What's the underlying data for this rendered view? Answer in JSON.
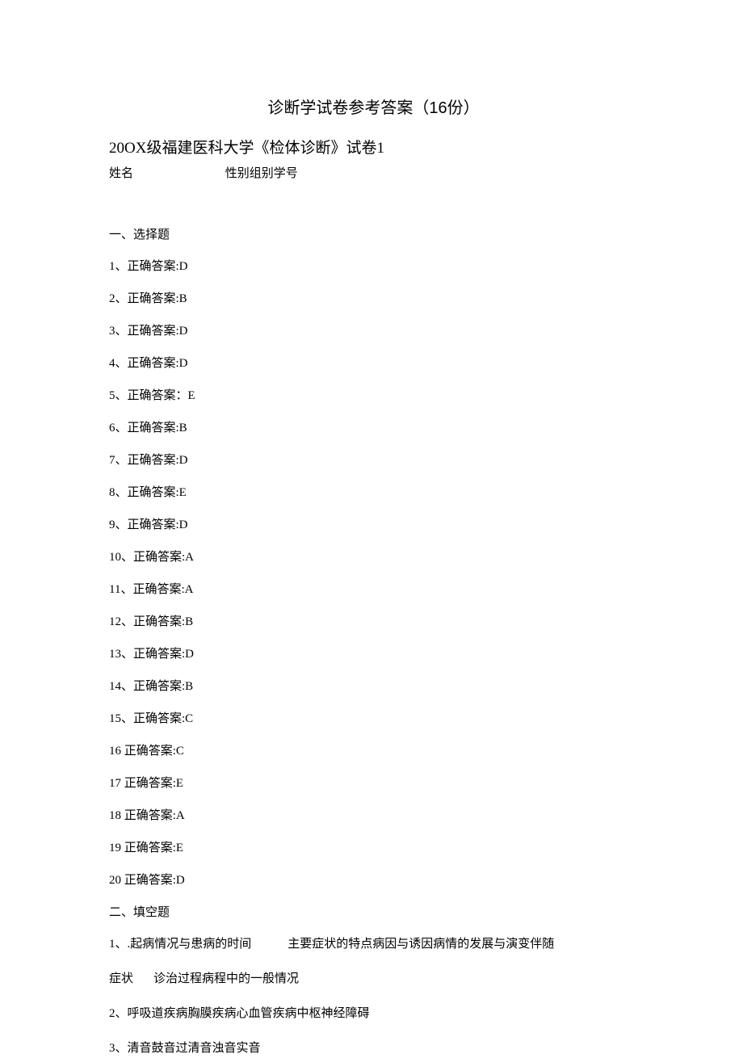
{
  "title": "诊断学试卷参考答案（16份）",
  "subtitle": "20OX级福建医科大学《检体诊断》试卷1",
  "info": {
    "name_label": "姓名",
    "fields_label": "性别组别学号"
  },
  "section1": {
    "header": "一、选择题",
    "answers": [
      {
        "num": "1、",
        "label": "正确答案:D"
      },
      {
        "num": "2、",
        "label": "正确答案:B"
      },
      {
        "num": "3、",
        "label": "正确答案:D"
      },
      {
        "num": "4、",
        "label": "正确答案:D"
      },
      {
        "num": "5、",
        "label": "正确答案：E"
      },
      {
        "num": "6、",
        "label": "正确答案:B"
      },
      {
        "num": "7、",
        "label": "正确答案:D"
      },
      {
        "num": "8、",
        "label": "正确答案:E"
      },
      {
        "num": "9、",
        "label": "正确答案:D"
      },
      {
        "num": "10、",
        "label": "正确答案:A"
      },
      {
        "num": "11、",
        "label": "正确答案:A"
      },
      {
        "num": "12、",
        "label": "正确答案:B"
      },
      {
        "num": "13、",
        "label": "正确答案:D"
      },
      {
        "num": "14、",
        "label": "正确答案:B"
      },
      {
        "num": "15、",
        "label": "正确答案:C"
      },
      {
        "num": "16",
        "label": "正确答案:C"
      },
      {
        "num": "17",
        "label": "正确答案:E"
      },
      {
        "num": "18",
        "label": "正确答案:A"
      },
      {
        "num": "19",
        "label": "正确答案:E"
      },
      {
        "num": "20",
        "label": "正确答案:D"
      }
    ]
  },
  "section2": {
    "header": "二、填空题",
    "item1_part1": "1、.起病情况与患病的时间",
    "item1_part2": "主要症状的特点病因与诱因病情的发展与演变伴随",
    "item1_line2_part1": "症状",
    "item1_line2_part2": "诊治过程病程中的一般情况",
    "item2": "2、呼吸道疾病胸膜疾病心血管疾病中枢神经障碍",
    "item3": "3、清音鼓音过清音浊音实音"
  }
}
